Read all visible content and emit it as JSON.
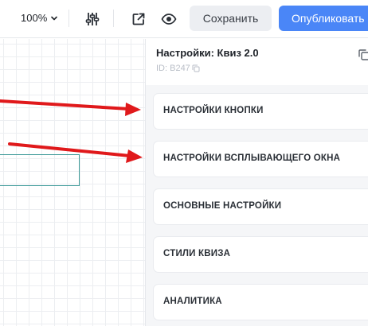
{
  "toolbar": {
    "zoom_label": "100%",
    "zoom_icon": "chevron-down-icon",
    "settings_icon": "sliders-icon",
    "open_icon": "external-link-icon",
    "preview_icon": "eye-icon",
    "save_label": "Сохранить",
    "publish_label": "Опубликовать"
  },
  "panel": {
    "title": "Настройки: Квиз 2.0",
    "id_label": "ID: B247",
    "copy_icon": "copy-icon",
    "sections": [
      {
        "label": "НАСТРОЙКИ КНОПКИ"
      },
      {
        "label": "НАСТРОЙКИ ВСПЛЫВАЮЩЕГО ОКНА"
      },
      {
        "label": "ОСНОВНЫЕ НАСТРОЙКИ"
      },
      {
        "label": "СТИЛИ КВИЗА"
      },
      {
        "label": "АНАЛИТИКА"
      }
    ]
  },
  "annotations": {
    "arrow_color": "#e0191b"
  },
  "colors": {
    "publish_bg": "#4a86f7",
    "save_bg": "#eceef2",
    "panel_bg": "#f5f6f8"
  }
}
